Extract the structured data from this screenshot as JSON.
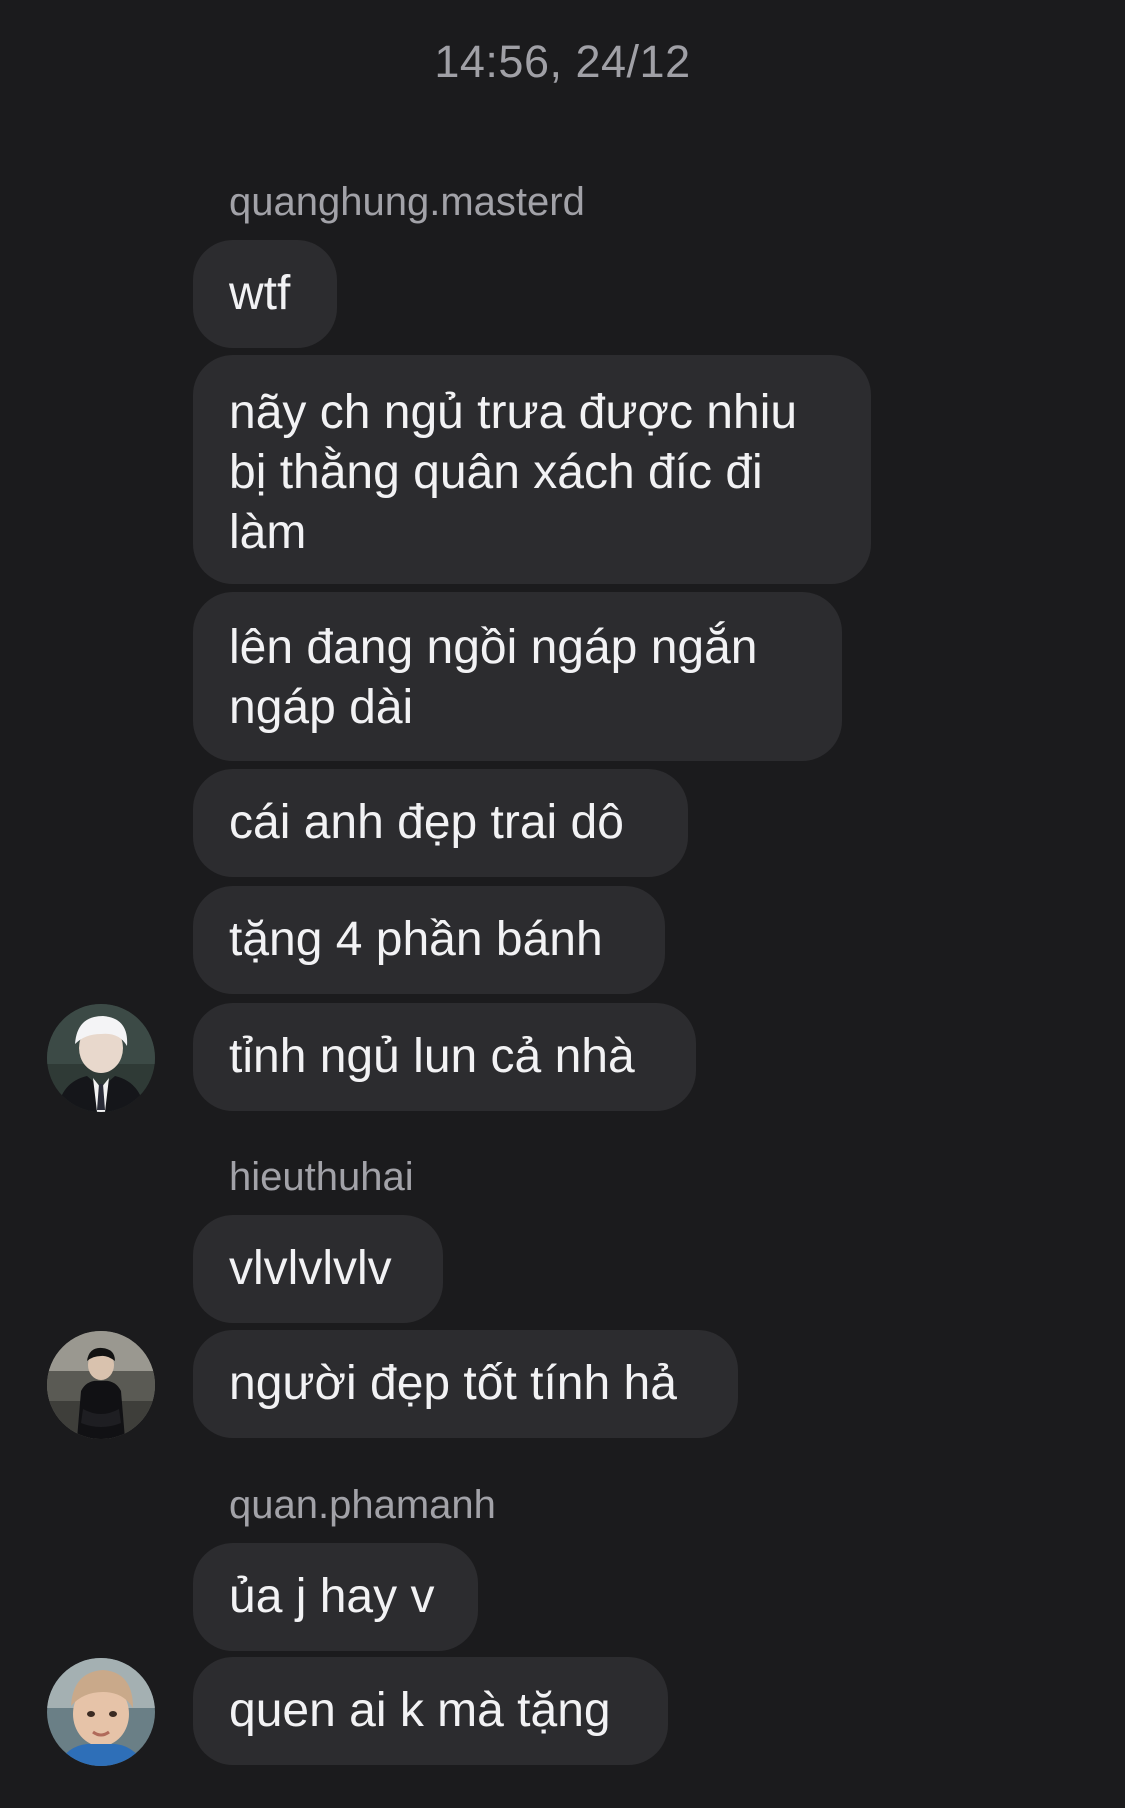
{
  "chat": {
    "timestamp": "14:56, 24/12",
    "groups": [
      {
        "sender": "quanghung.masterd",
        "avatar_icon": "avatar-quanghung",
        "messages": [
          "wtf",
          "nãy ch ngủ trưa được nhiu bị thằng quân xách đíc đi làm",
          "lên đang ngồi ngáp ngắn ngáp dài",
          "cái anh đẹp trai dô",
          "tặng 4 phần bánh",
          "tỉnh ngủ lun cả nhà"
        ]
      },
      {
        "sender": "hieuthuhai",
        "avatar_icon": "avatar-hieuthuhai",
        "messages": [
          "vlvlvlvlv",
          "người đẹp tốt tính hả"
        ]
      },
      {
        "sender": "quan.phamanh",
        "avatar_icon": "avatar-quanphamanh",
        "messages": [
          "ủa j hay v",
          "quen ai k mà tặng"
        ]
      }
    ]
  },
  "colors": {
    "background": "#1b1b1d",
    "bubble": "#2c2c2f",
    "text": "#f2f2f4",
    "muted": "#a0a0a6"
  }
}
